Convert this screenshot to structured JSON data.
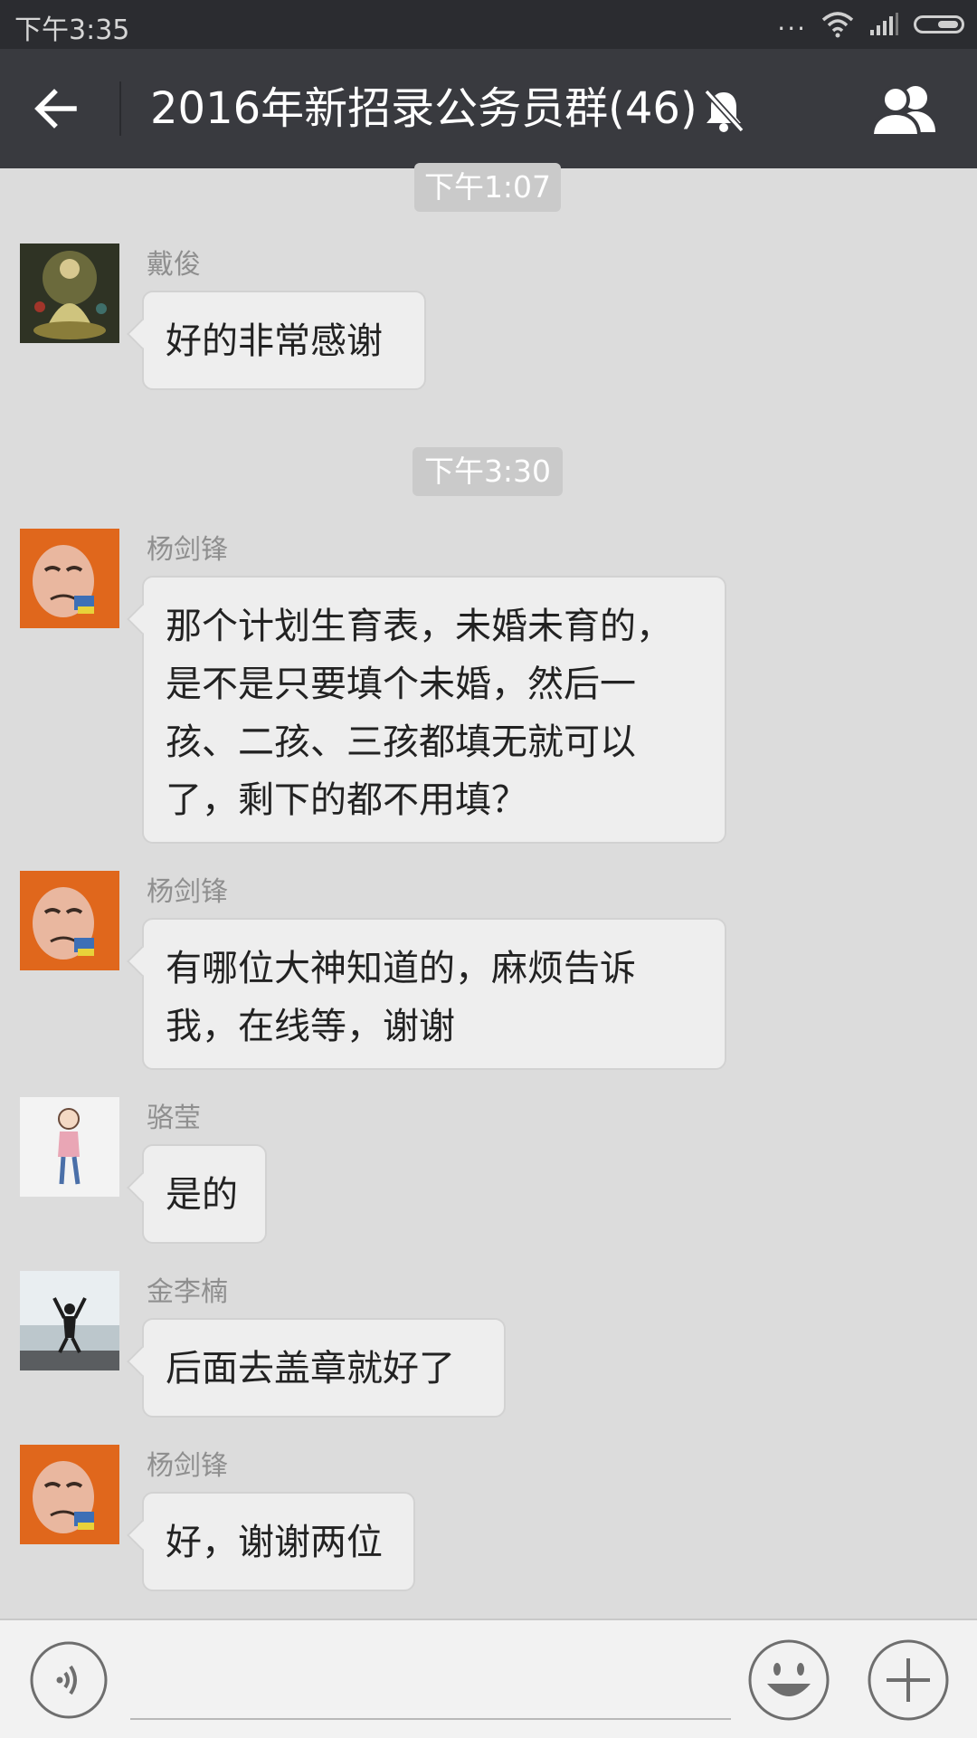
{
  "status_bar": {
    "time": "下午3:35",
    "dots": "..."
  },
  "header": {
    "title": "2016年新招录公务员群(46)"
  },
  "chat": {
    "timestamps": [
      "下午1:07",
      "下午3:30"
    ],
    "messages": [
      {
        "sender": "戴俊",
        "text": "好的非常感谢",
        "avatar": "thangka-painting-avatar"
      },
      {
        "sender": "杨剑锋",
        "text": "那个计划生育表，未婚未育的，\n是不是只要填个未婚，然后一\n孩、二孩、三孩都填无就可以\n了，剩下的都不用填？",
        "avatar": "cartoon-doll-avatar"
      },
      {
        "sender": "杨剑锋",
        "text": "有哪位大神知道的，麻烦告诉\n我，在线等，谢谢",
        "avatar": "cartoon-doll-avatar"
      },
      {
        "sender": "骆莹",
        "text": "是的",
        "avatar": "cartoon-girl-avatar"
      },
      {
        "sender": "金李楠",
        "text": "后面去盖章就好了",
        "avatar": "person-jumping-avatar"
      },
      {
        "sender": "杨剑锋",
        "text": "好，谢谢两位",
        "avatar": "cartoon-doll-avatar"
      }
    ]
  },
  "input": {
    "value": ""
  },
  "colors": {
    "status_bar_bg": "#2b2c30",
    "title_bar_bg": "#393a3f",
    "chat_bg": "#dcdcdc",
    "bubble_bg": "#eeeeee",
    "sender_text": "#8f8f8f",
    "time_pill_bg": "#cacaca"
  }
}
